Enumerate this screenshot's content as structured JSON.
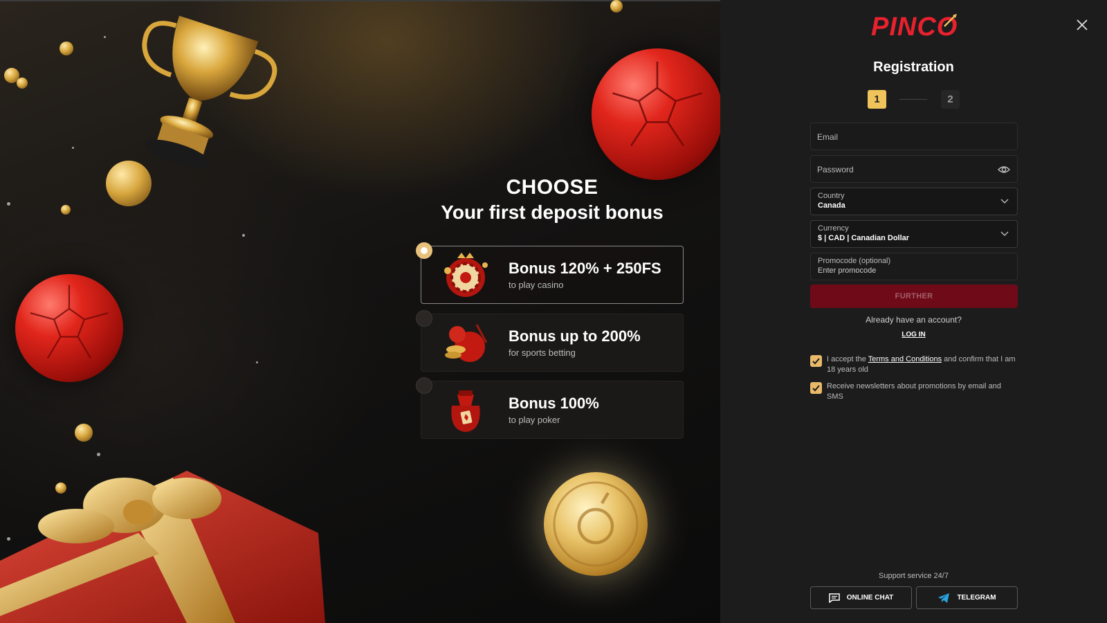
{
  "promo": {
    "title_line1": "CHOOSE",
    "title_line2": "Your first deposit bonus",
    "bonuses": [
      {
        "title": "Bonus 120% + 250FS",
        "subtitle": "to play casino",
        "selected": true,
        "icon": "roulette-icon"
      },
      {
        "title": "Bonus up to 200%",
        "subtitle": "for sports betting",
        "selected": false,
        "icon": "soccer-ball-icon"
      },
      {
        "title": "Bonus 100%",
        "subtitle": "to play poker",
        "selected": false,
        "icon": "poker-bag-icon"
      }
    ]
  },
  "registration": {
    "logo": "PINCO",
    "title": "Registration",
    "steps": [
      "1",
      "2"
    ],
    "active_step": 1,
    "fields": {
      "email": {
        "placeholder": "Email"
      },
      "password": {
        "placeholder": "Password"
      },
      "country": {
        "label": "Country",
        "value": "Canada"
      },
      "currency": {
        "label": "Currency",
        "value": "$ | CAD | Canadian Dollar"
      },
      "promocode": {
        "label": "Promocode (optional)",
        "placeholder": "Enter promocode"
      }
    },
    "further_label": "FURTHER",
    "already_text": "Already have an account?",
    "login_label": "LOG IN",
    "terms": {
      "prefix": "I accept the ",
      "link": "Terms and Conditions",
      "suffix": " and confirm that I am 18 years old",
      "checked": true
    },
    "newsletter": {
      "text": "Receive newsletters about promotions by email and SMS",
      "checked": true
    },
    "support_text": "Support service 24/7",
    "online_chat_label": "ONLINE CHAT",
    "telegram_label": "TELEGRAM"
  },
  "colors": {
    "brand_red": "#e8212e",
    "accent_gold": "#f0c35b",
    "button_red": "#6f0b19",
    "panel_bg": "#1c1c1c"
  }
}
